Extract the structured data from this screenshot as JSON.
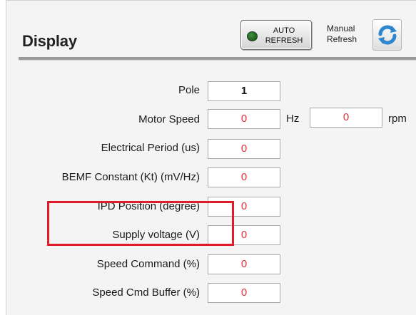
{
  "panel": {
    "title": "Display"
  },
  "auto_refresh": {
    "line1": "AUTO",
    "line2": "REFRESH",
    "indicator_color": "#1f5f1f"
  },
  "manual_refresh": {
    "line1": "Manual",
    "line2": "Refresh",
    "icon": "refresh-icon"
  },
  "fields": [
    {
      "label": "Pole",
      "value": "1"
    },
    {
      "label": "Motor Speed",
      "value": "0",
      "unit": "Hz",
      "value2": "0",
      "unit2": "rpm"
    },
    {
      "label": "Electrical Period (us)",
      "value": "0"
    },
    {
      "label": "BEMF Constant (Kt) (mV/Hz)",
      "value": "0"
    },
    {
      "label": "IPD Position (degree)",
      "value": "0"
    },
    {
      "label": "Supply voltage (V)",
      "value": "0"
    },
    {
      "label": "Speed Command (%)",
      "value": "0"
    },
    {
      "label": "Speed Cmd Buffer (%)",
      "value": "0"
    }
  ],
  "colors": {
    "value_red": "#e0303a",
    "highlight_red": "#e11c2a"
  }
}
